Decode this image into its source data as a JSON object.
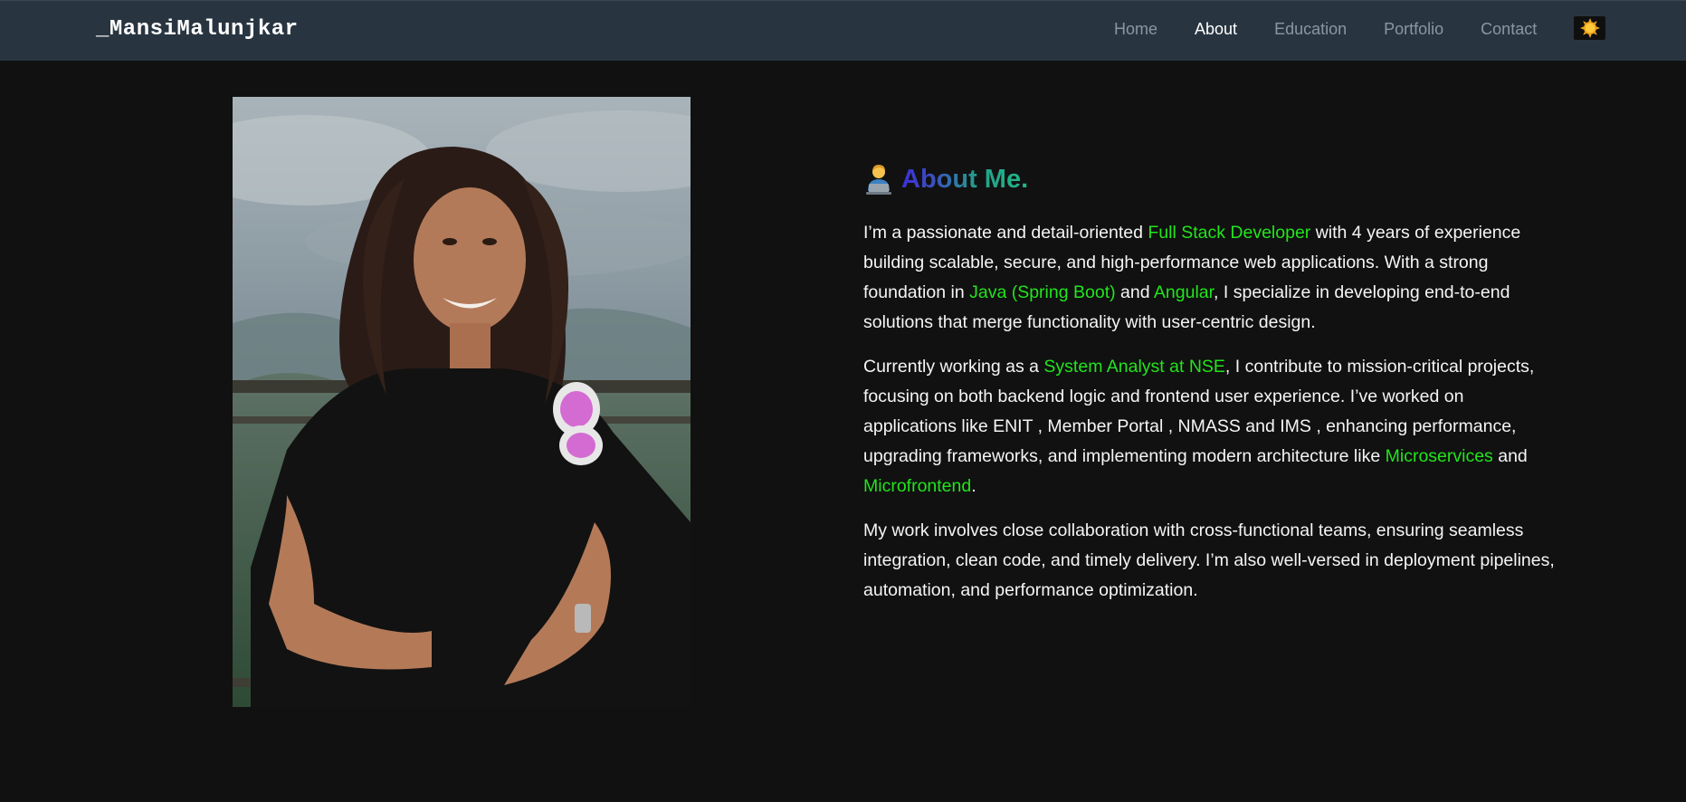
{
  "nav": {
    "brand": "_MansiMalunjkar",
    "links": [
      {
        "label": "Home",
        "active": false
      },
      {
        "label": "About",
        "active": true
      },
      {
        "label": "Education",
        "active": false
      },
      {
        "label": "Portfolio",
        "active": false
      },
      {
        "label": "Contact",
        "active": false
      }
    ],
    "theme_icon": "sun-icon"
  },
  "photo": {
    "icon": "profile-photo"
  },
  "about": {
    "emoji_icon": "technologist-icon",
    "title": "About Me.",
    "p1": {
      "t1": "I’m a passionate and detail-oriented ",
      "h1": "Full Stack Developer",
      "t2": " with 4 years of experience building scalable, secure, and high-performance web applications. With a strong foundation in ",
      "h2": "Java (Spring Boot)",
      "t3": " and ",
      "h3": "Angular",
      "t4": ", I specialize in developing end-to-end solutions that merge functionality with user-centric design."
    },
    "p2": {
      "t1": "Currently working as a ",
      "h1": "System Analyst at NSE",
      "t2": ", I contribute to mission-critical projects, focusing on both backend logic and frontend user experience. I’ve worked on applications like ENIT , Member Portal , NMASS and IMS , enhancing performance, upgrading frameworks, and implementing modern architecture like ",
      "h2": "Microservices",
      "t3": " and ",
      "h3": "Microfrontend",
      "t4": "."
    },
    "p3": "My work involves close collaboration with cross-functional teams, ensuring seamless integration, clean code, and timely delivery. I’m also well-versed in deployment pipelines, automation, and performance optimization."
  },
  "colors": {
    "navbar_bg": "#283541",
    "page_bg": "#111111",
    "highlight": "#22e51c",
    "nav_inactive": "#8c96a0",
    "title_gradient_start": "#3b2fd8",
    "title_gradient_end": "#20b787"
  }
}
